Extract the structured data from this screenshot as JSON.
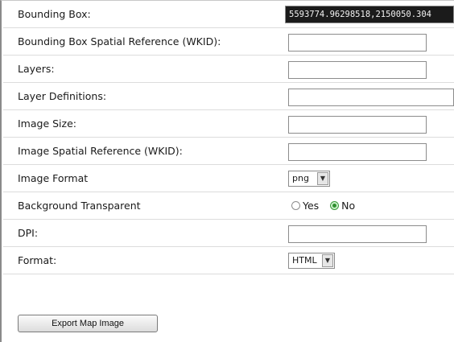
{
  "form": {
    "bbox": {
      "label": "Bounding Box:",
      "value": "5593774.96298518,2150050.304"
    },
    "bbox_sr": {
      "label": "Bounding Box Spatial Reference (WKID):",
      "value": ""
    },
    "layers": {
      "label": "Layers:",
      "value": ""
    },
    "layer_defs": {
      "label": "Layer Definitions:",
      "value": ""
    },
    "image_size": {
      "label": "Image Size:",
      "value": ""
    },
    "image_sr": {
      "label": "Image Spatial Reference (WKID):",
      "value": ""
    },
    "image_format": {
      "label": "Image Format",
      "selected": "png"
    },
    "transparent": {
      "label": "Background Transparent",
      "yes": "Yes",
      "no": "No",
      "selected": "No"
    },
    "dpi": {
      "label": "DPI:",
      "value": ""
    },
    "format": {
      "label": "Format:",
      "selected": "HTML"
    },
    "export_button": "Export Map Image"
  },
  "icons": {
    "dropdown_arrow": "chevron-down-icon"
  },
  "colors": {
    "radio_checked": "#2f8f2f",
    "filled_field_bg": "#1b1b1b"
  }
}
